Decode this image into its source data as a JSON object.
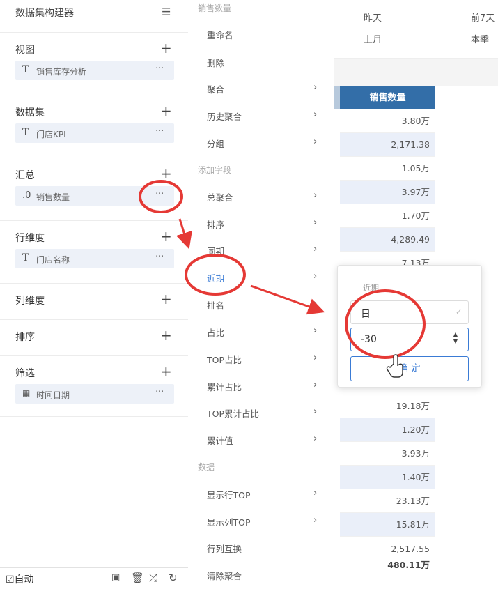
{
  "builder": {
    "title": "数据集构建器",
    "sections": [
      {
        "title": "视图",
        "chip": {
          "type": "T",
          "text": "销售库存分析"
        }
      },
      {
        "title": "数据集",
        "chip": {
          "type": "T",
          "text": "门店KPI"
        }
      },
      {
        "title": "汇总",
        "chip": {
          "type": ".0",
          "text": "销售数量"
        }
      },
      {
        "title": "行维度",
        "chip": {
          "type": "T",
          "text": "门店名称"
        }
      },
      {
        "title": "列维度"
      },
      {
        "title": "排序"
      },
      {
        "title": "筛选",
        "chip": {
          "type": "▦",
          "text": "时间日期"
        }
      }
    ],
    "footer": {
      "auto_label": "☑自动"
    }
  },
  "menu": {
    "groups": [
      "销售数量",
      "添加字段",
      "数据"
    ],
    "items": [
      {
        "label": "重命名"
      },
      {
        "label": "删除"
      },
      {
        "label": "聚合"
      },
      {
        "label": "历史聚合"
      },
      {
        "label": "分组"
      },
      {
        "label": "总聚合"
      },
      {
        "label": "排序"
      },
      {
        "label": "同期"
      },
      {
        "label": "近期"
      },
      {
        "label": "排名"
      },
      {
        "label": "占比"
      },
      {
        "label": "TOP占比"
      },
      {
        "label": "累计占比"
      },
      {
        "label": "TOP累计占比"
      },
      {
        "label": "累计值"
      },
      {
        "label": "显示行TOP"
      },
      {
        "label": "显示列TOP"
      },
      {
        "label": "行列互换"
      },
      {
        "label": "清除聚合"
      }
    ]
  },
  "quick_dates": [
    "昨天",
    "前7天",
    "上月",
    "本季"
  ],
  "table": {
    "header": "销售数量",
    "rows": [
      "3.80万",
      "2,171.38",
      "1.05万",
      "3.97万",
      "1.70万",
      "4,289.49",
      "7.13万",
      "19.18万",
      "1.20万",
      "3.93万",
      "1.40万",
      "23.13万",
      "15.81万",
      "2,517.55"
    ],
    "total": "480.11万"
  },
  "popover": {
    "label": "近期",
    "unit": "日",
    "value": "-30",
    "ok_label": "确 定"
  },
  "colors": {
    "accent": "#3a7bd5",
    "header_bg": "#336ea8",
    "row_alt": "#eaeff9",
    "annotation": "#e53935"
  }
}
